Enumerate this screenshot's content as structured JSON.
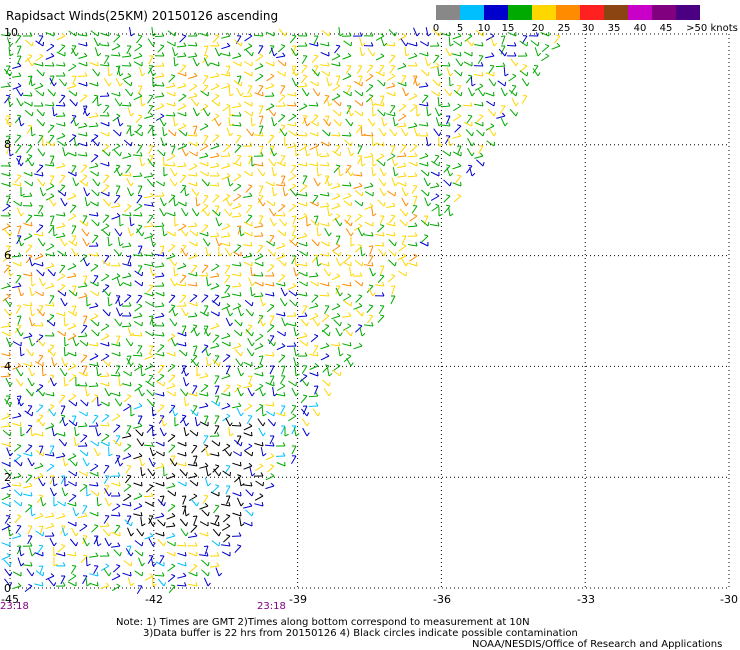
{
  "title": "Rapidsact Winds(25KM) 20150126 ascending",
  "legend": {
    "labels": [
      "0",
      "5",
      "10",
      "15",
      "20",
      "25",
      "30",
      "35",
      "40",
      "45",
      ">50 knots"
    ],
    "colors": [
      "#555555",
      "#888888",
      "#00bfff",
      "#0000cd",
      "#00aa00",
      "#ffd700",
      "#ff8c00",
      "#ff2020",
      "#8b4513",
      "#c800c8",
      "#800080",
      "#4b0082"
    ]
  },
  "map": {
    "x_ticks": [
      "-45",
      "-42",
      "-39",
      "-36",
      "-33",
      "-30"
    ],
    "y_ticks": [
      "10",
      "8",
      "6",
      "4",
      "2",
      "0"
    ],
    "x_range": [
      -45,
      -30
    ],
    "y_range": [
      0,
      10
    ]
  },
  "time_labels": [
    "23:18",
    "23:18"
  ],
  "notes": {
    "line1": "Note: 1) Times are GMT 2)Times along bottom correspond to measurement at 10N",
    "line2": "3)Data buffer is 22 hrs from 20150126 4) Black circles indicate possible contamination",
    "credit": "NOAA/NESDIS/Office of Research and Applications"
  }
}
